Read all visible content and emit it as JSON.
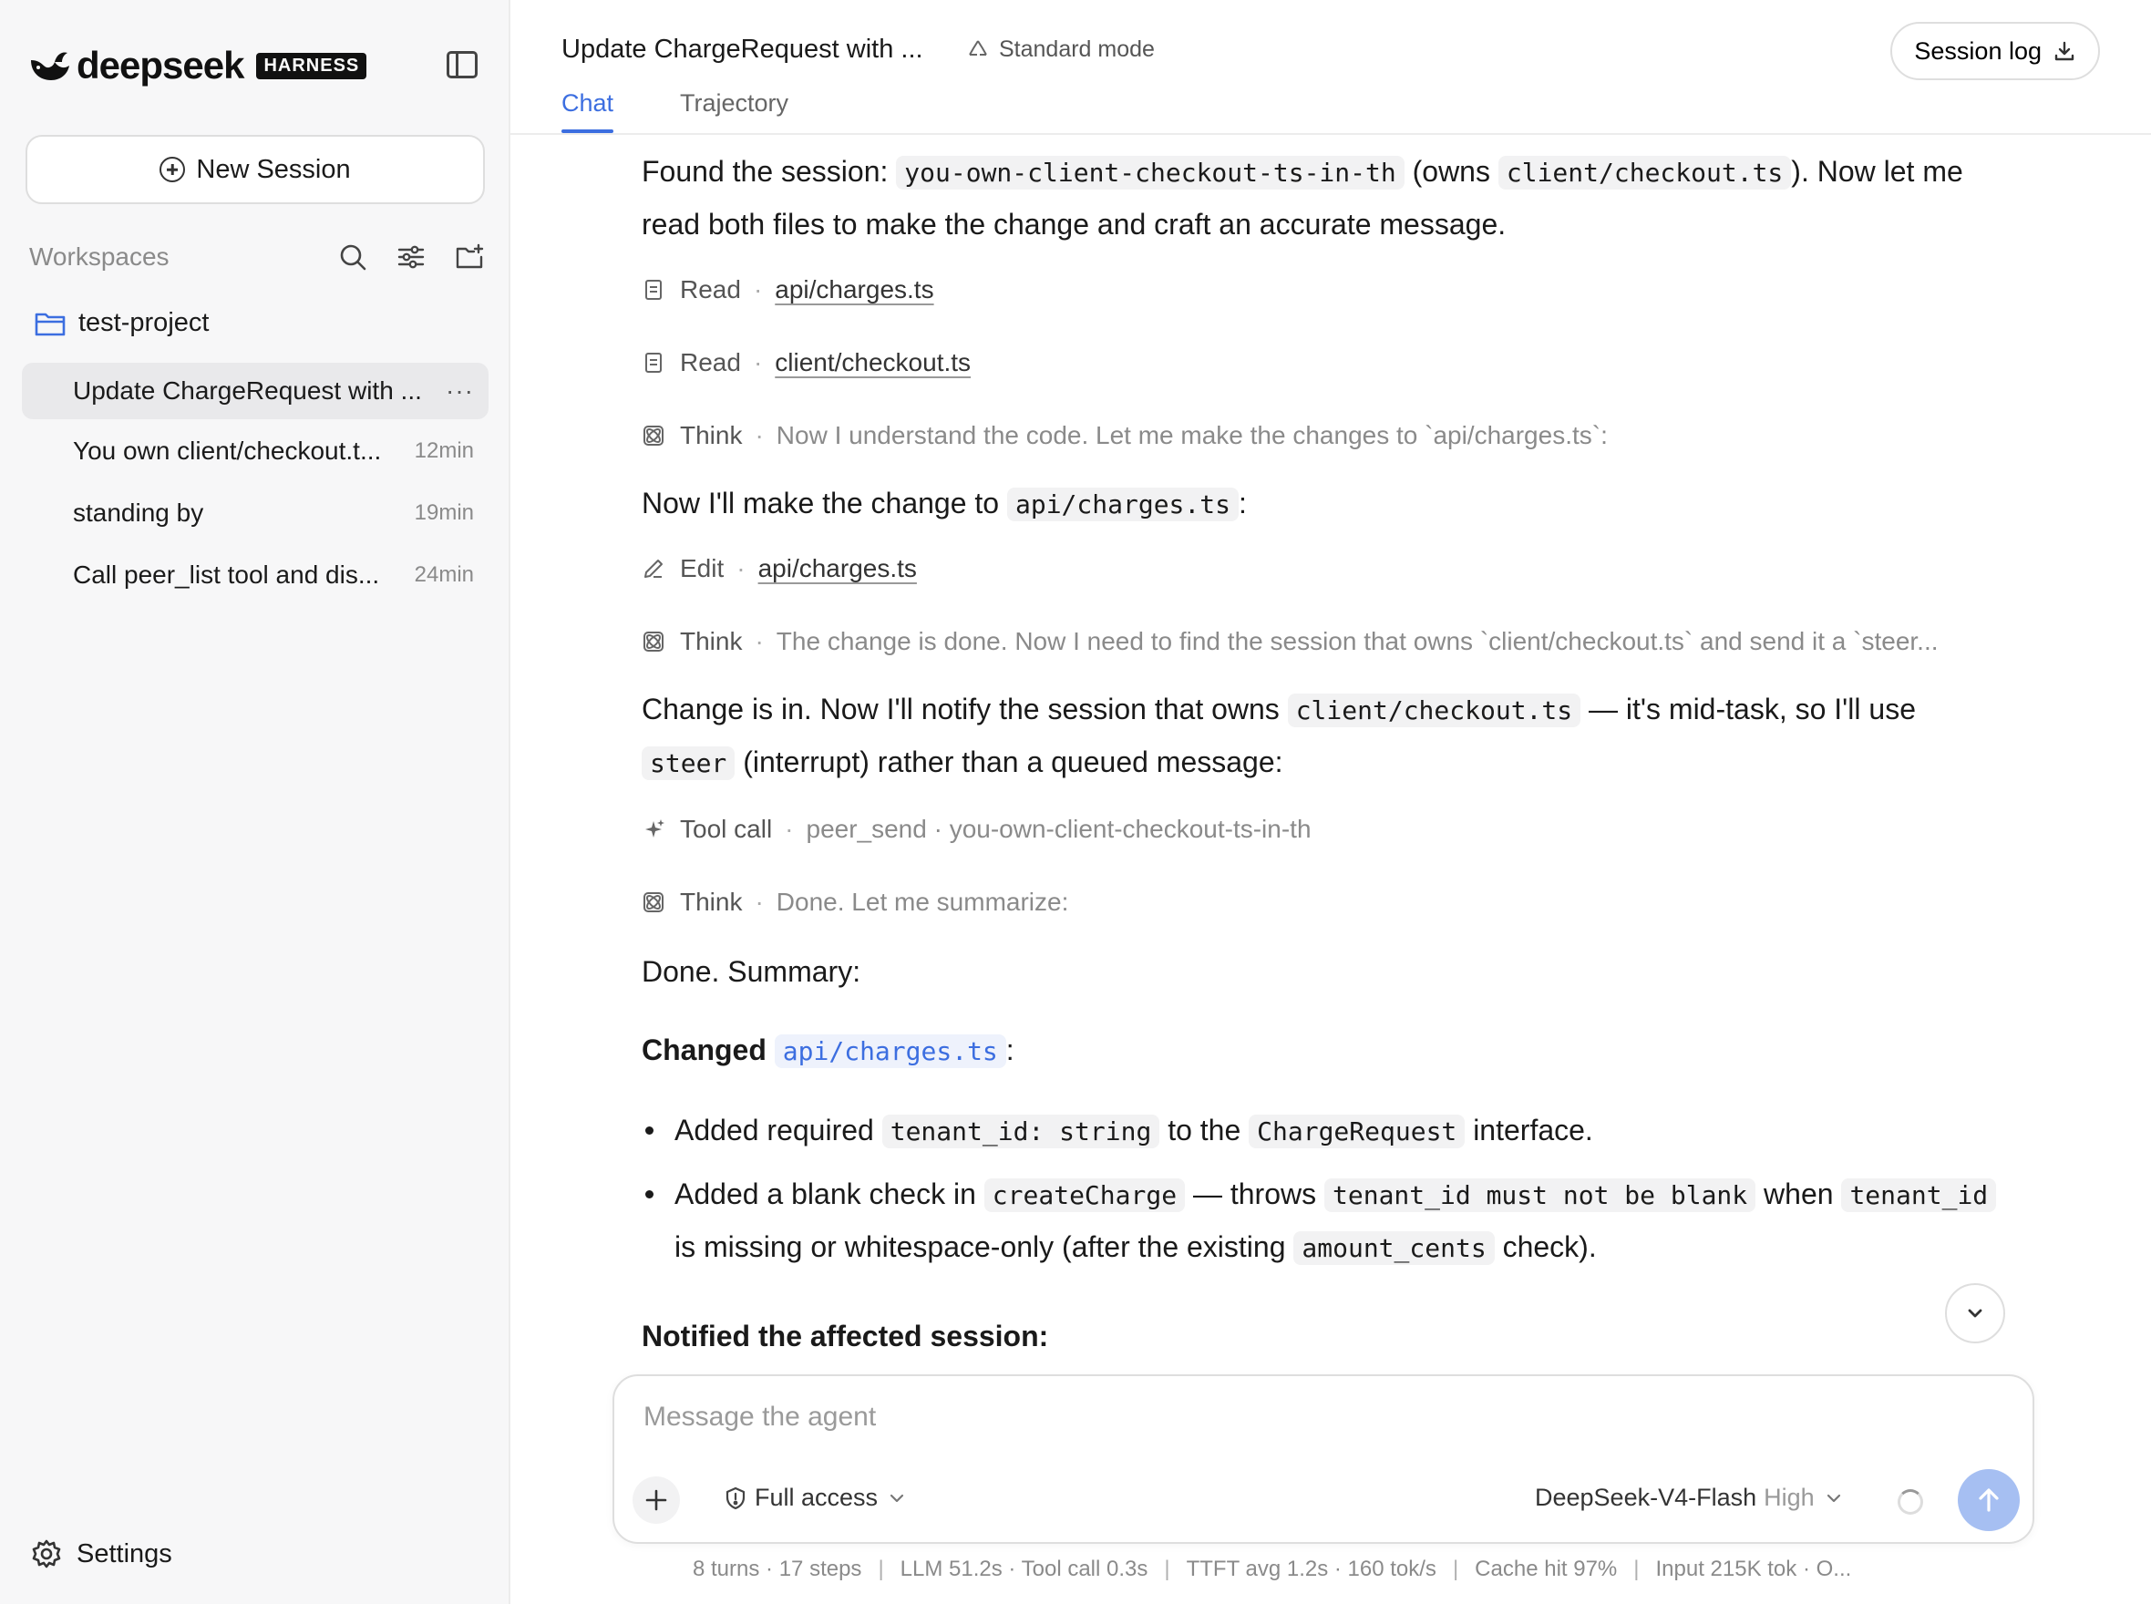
{
  "sidebar": {
    "logo_text": "deepseek",
    "logo_badge": "HARNESS",
    "new_session_label": "New Session",
    "workspaces_label": "Workspaces",
    "project_name": "test-project",
    "sessions": [
      {
        "title": "Update ChargeRequest with ...",
        "time": ""
      },
      {
        "title": "You own client/checkout.t...",
        "time": "12min"
      },
      {
        "title": "standing by",
        "time": "19min"
      },
      {
        "title": "Call peer_list tool and dis...",
        "time": "24min"
      }
    ],
    "active_menu": "···",
    "settings_label": "Settings"
  },
  "header": {
    "title": "Update ChargeRequest with ...",
    "mode": "Standard mode",
    "session_log": "Session log",
    "tabs": [
      "Chat",
      "Trajectory"
    ]
  },
  "chat": {
    "m1": {
      "t1": "Found the session: ",
      "c1": "you-own-client-checkout-ts-in-th",
      "t2": " (owns ",
      "c2": "client/checkout.ts",
      "t3": "). Now let me read both files to make the change and craft an accurate message."
    },
    "steps1": [
      {
        "name": "Read",
        "target": "api/charges.ts"
      },
      {
        "name": "Read",
        "target": "client/checkout.ts"
      },
      {
        "name": "Think",
        "detail": "Now I understand the code. Let me make the changes to `api/charges.ts`:"
      }
    ],
    "m2": {
      "t1": "Now I'll make the change to ",
      "c1": "api/charges.ts",
      "t2": ":"
    },
    "steps2": [
      {
        "name": "Edit",
        "target": "api/charges.ts"
      },
      {
        "name": "Think",
        "detail": "The change is done. Now I need to find the session that owns `client/checkout.ts` and send it a `steer..."
      }
    ],
    "m3": {
      "t1": "Change is in. Now I'll notify the session that owns ",
      "c1": "client/checkout.ts",
      "t2": " — it's mid-task, so I'll use ",
      "c2": "steer",
      "t3": " (interrupt) rather than a queued message:"
    },
    "steps3": [
      {
        "name": "Tool call",
        "detail": "peer_send · you-own-client-checkout-ts-in-th"
      },
      {
        "name": "Think",
        "detail": "Done. Let me summarize:"
      }
    ],
    "m4": "Done. Summary:",
    "changed": {
      "label": "Changed",
      "file": "api/charges.ts",
      "colon": ":"
    },
    "b1": {
      "t1": "Added required ",
      "c1": "tenant_id: string",
      "t2": " to the ",
      "c2": "ChargeRequest",
      "t3": " interface."
    },
    "b2": {
      "t1": "Added a blank check in ",
      "c1": "createCharge",
      "t2": " — throws ",
      "c2": "tenant_id must not be blank",
      "t3": " when ",
      "c3": "tenant_id",
      "t4": " is missing or whitespace-only (after the existing ",
      "c4": "amount_cents",
      "t5": " check)."
    },
    "cutoff_heading": "Notified the affected session:"
  },
  "composer": {
    "placeholder": "Message the agent",
    "access": "Full access",
    "model": "DeepSeek-V4-Flash",
    "effort": "High"
  },
  "stats": [
    "8 turns · 17 steps",
    "LLM 51.2s · Tool call 0.3s",
    "TTFT avg 1.2s · 160 tok/s",
    "Cache hit 97%",
    "Input 215K tok · O..."
  ],
  "colors": {
    "accent": "#3c6ee0",
    "send_button": "#a6bff2",
    "sidebar_bg": "#f7f7f8"
  }
}
